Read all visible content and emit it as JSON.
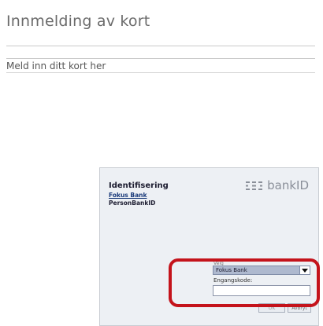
{
  "page": {
    "title": "Innmelding av kort",
    "section_heading": "Meld inn ditt kort her"
  },
  "bankid": {
    "title": "Identifisering",
    "bank_link": "Fokus Bank",
    "subtitle": "PersonBankID",
    "logo_text": "bankID",
    "bank_label": "Velg",
    "bank_selected": "Fokus Bank",
    "code_label": "Engangskode:",
    "code_value": "",
    "ok_label": "OK",
    "cancel_label": "Avbryt"
  },
  "colors": {
    "highlight": "#c4131b",
    "select_bg": "#aeb9cf"
  }
}
